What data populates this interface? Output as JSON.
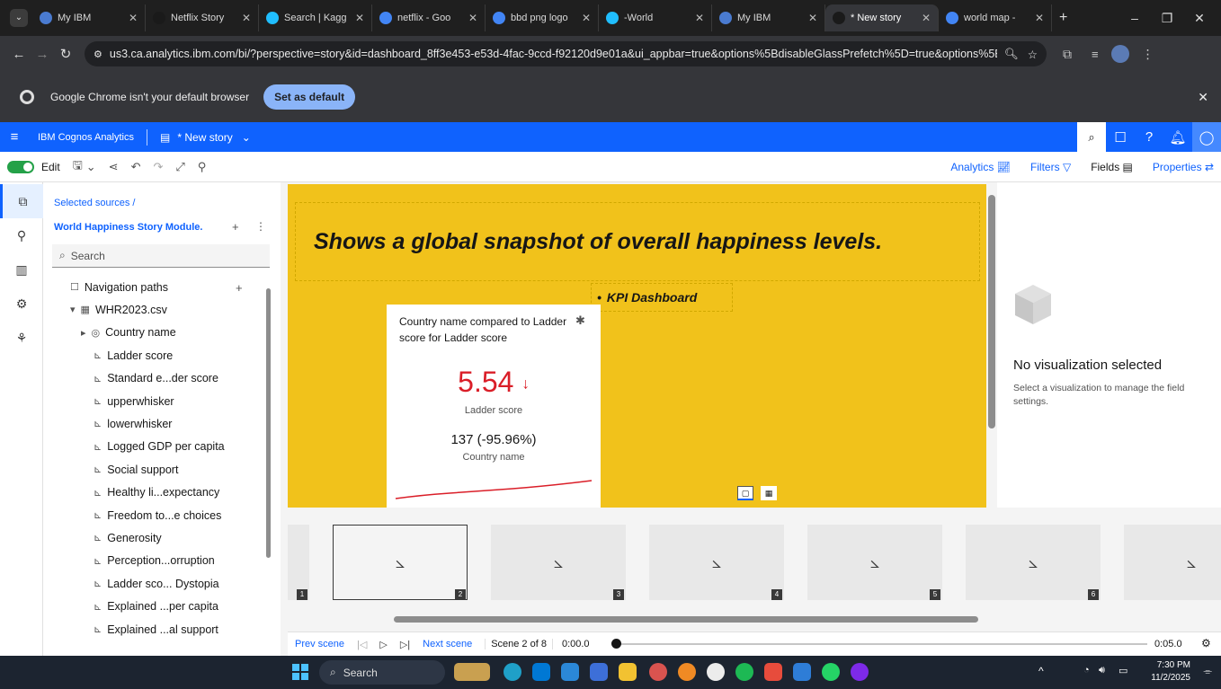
{
  "browser": {
    "tabs": [
      {
        "title": "My IBM",
        "active": false
      },
      {
        "title": "Netflix Story",
        "active": false
      },
      {
        "title": "Search | Kagg",
        "active": false
      },
      {
        "title": "netflix - Goo",
        "active": false
      },
      {
        "title": "bbd png logo",
        "active": false
      },
      {
        "title": "-World",
        "active": false
      },
      {
        "title": "My IBM",
        "active": false
      },
      {
        "title": "* New story",
        "active": true
      },
      {
        "title": "world map -",
        "active": false
      }
    ],
    "url": "us3.ca.analytics.ibm.com/bi/?perspective=story&id=dashboard_8ff3e453-e53d-4fac-9ccd-f92120d9e01a&ui_appbar=true&options%5BdisableGlassPrefetch%5D=true&options%5Bc...",
    "default_notice": "Google Chrome isn't your default browser",
    "set_default_label": "Set as default"
  },
  "app": {
    "name": "IBM Cognos Analytics",
    "doc_title": "* New story"
  },
  "toolbar": {
    "edit_label": "Edit",
    "right_tabs": [
      "Analytics",
      "Filters",
      "Fields",
      "Properties"
    ]
  },
  "sources": {
    "breadcrumb": "Selected sources  /",
    "module": "World Happiness Story Module.",
    "search_placeholder": "Search",
    "tree": [
      {
        "label": "Navigation paths",
        "icon": "folder-icon",
        "level": 1
      },
      {
        "label": "WHR2023.csv",
        "icon": "table-icon",
        "level": 1
      },
      {
        "label": "Country name",
        "icon": "location-icon",
        "level": 2
      },
      {
        "label": "Ladder score",
        "icon": "measure-icon",
        "level": 3
      },
      {
        "label": "Standard e...der score",
        "icon": "measure-icon",
        "level": 3
      },
      {
        "label": "upperwhisker",
        "icon": "measure-icon",
        "level": 3
      },
      {
        "label": "lowerwhisker",
        "icon": "measure-icon",
        "level": 3
      },
      {
        "label": "Logged GDP per capita",
        "icon": "measure-icon",
        "level": 3
      },
      {
        "label": "Social support",
        "icon": "measure-icon",
        "level": 3
      },
      {
        "label": "Healthy li...expectancy",
        "icon": "measure-icon",
        "level": 3
      },
      {
        "label": "Freedom to...e choices",
        "icon": "measure-icon",
        "level": 3
      },
      {
        "label": "Generosity",
        "icon": "measure-icon",
        "level": 3
      },
      {
        "label": "Perception...orruption",
        "icon": "measure-icon",
        "level": 3
      },
      {
        "label": "Ladder sco... Dystopia",
        "icon": "measure-icon",
        "level": 3
      },
      {
        "label": "Explained ...per capita",
        "icon": "measure-icon",
        "level": 3
      },
      {
        "label": "Explained ...al support",
        "icon": "measure-icon",
        "level": 3
      }
    ]
  },
  "canvas": {
    "title": "Shows a global snapshot of overall happiness levels.",
    "bullet": "KPI Dashboard",
    "kpi": {
      "title": "Country name compared to Ladder score for Ladder score",
      "value": "5.54",
      "trend": "↓",
      "measure_label": "Ladder score",
      "count": "137 (-95.96%)",
      "count_label": "Country name"
    }
  },
  "properties": {
    "empty_title": "No visualization selected",
    "empty_desc": "Select a visualization to manage the field settings."
  },
  "scenes": {
    "numbers": [
      "1",
      "2",
      "3",
      "4",
      "5",
      "6"
    ],
    "selected": 2
  },
  "playback": {
    "prev": "Prev scene",
    "next": "Next scene",
    "scene_info": "Scene 2 of 8",
    "start_time": "0:00.0",
    "end_time": "0:05.0",
    "progress": 0
  },
  "taskbar": {
    "search": "Search",
    "time": "7:30 PM",
    "date": "11/2/2025"
  },
  "colors": {
    "brand": "#0f62fe",
    "slide_bg": "#f1c21b",
    "kpi_value": "#da1e28"
  }
}
